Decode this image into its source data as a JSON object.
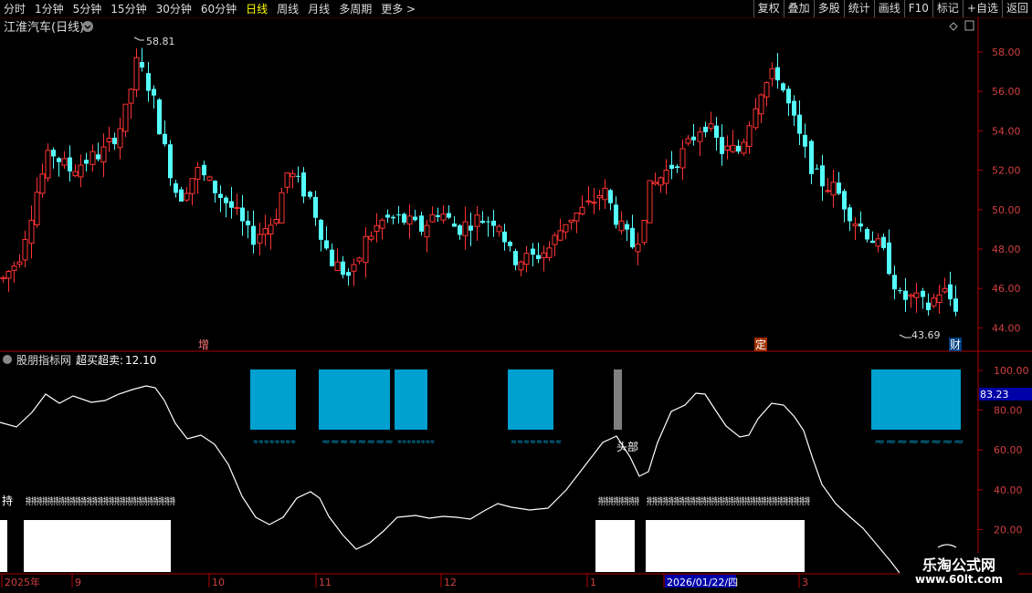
{
  "toolbar": {
    "periods": [
      "分时",
      "1分钟",
      "5分钟",
      "15分钟",
      "30分钟",
      "60分钟",
      "日线",
      "周线",
      "月线",
      "多周期",
      "更多 >"
    ],
    "active_period": "日线",
    "actions": [
      "复权",
      "叠加",
      "多股",
      "统计",
      "画线",
      "F10",
      "标记",
      "+自选",
      "返回"
    ]
  },
  "main_panel": {
    "title": "江淮汽车(日线)",
    "high_label": "58.81",
    "low_label": "43.69",
    "y_ticks": [
      "58.00",
      "56.00",
      "54.00",
      "52.00",
      "50.00",
      "48.00",
      "46.00",
      "44.00"
    ],
    "event_markers": [
      "增",
      "定",
      "财"
    ]
  },
  "indicator_panel": {
    "title": "股朋指标网",
    "indicator_name": "超买超卖:",
    "indicator_value": "12.10",
    "current_value_badge": "83.23",
    "y_ticks": [
      "100.00",
      "80.00",
      "60.00",
      "40.00",
      "20.00"
    ],
    "head_label": "头部",
    "hold_label": "持",
    "cyan_wave_glyphs": "≈≈≈≈≈≈≈≈",
    "hold_glyph": "持"
  },
  "date_axis": {
    "labels": [
      "2025年",
      "9",
      "10",
      "11",
      "12",
      "1",
      "2026/01/22/四",
      "3"
    ]
  },
  "watermark": {
    "line1": "乐淘公式网",
    "line2": "www.60lt.com"
  },
  "colors": {
    "up": "#ff3333",
    "down": "#54ffff",
    "axis": "#b00000",
    "highlight_block": "#00a0d0",
    "head_bar": "#808080",
    "badge": "#0000a8"
  }
}
